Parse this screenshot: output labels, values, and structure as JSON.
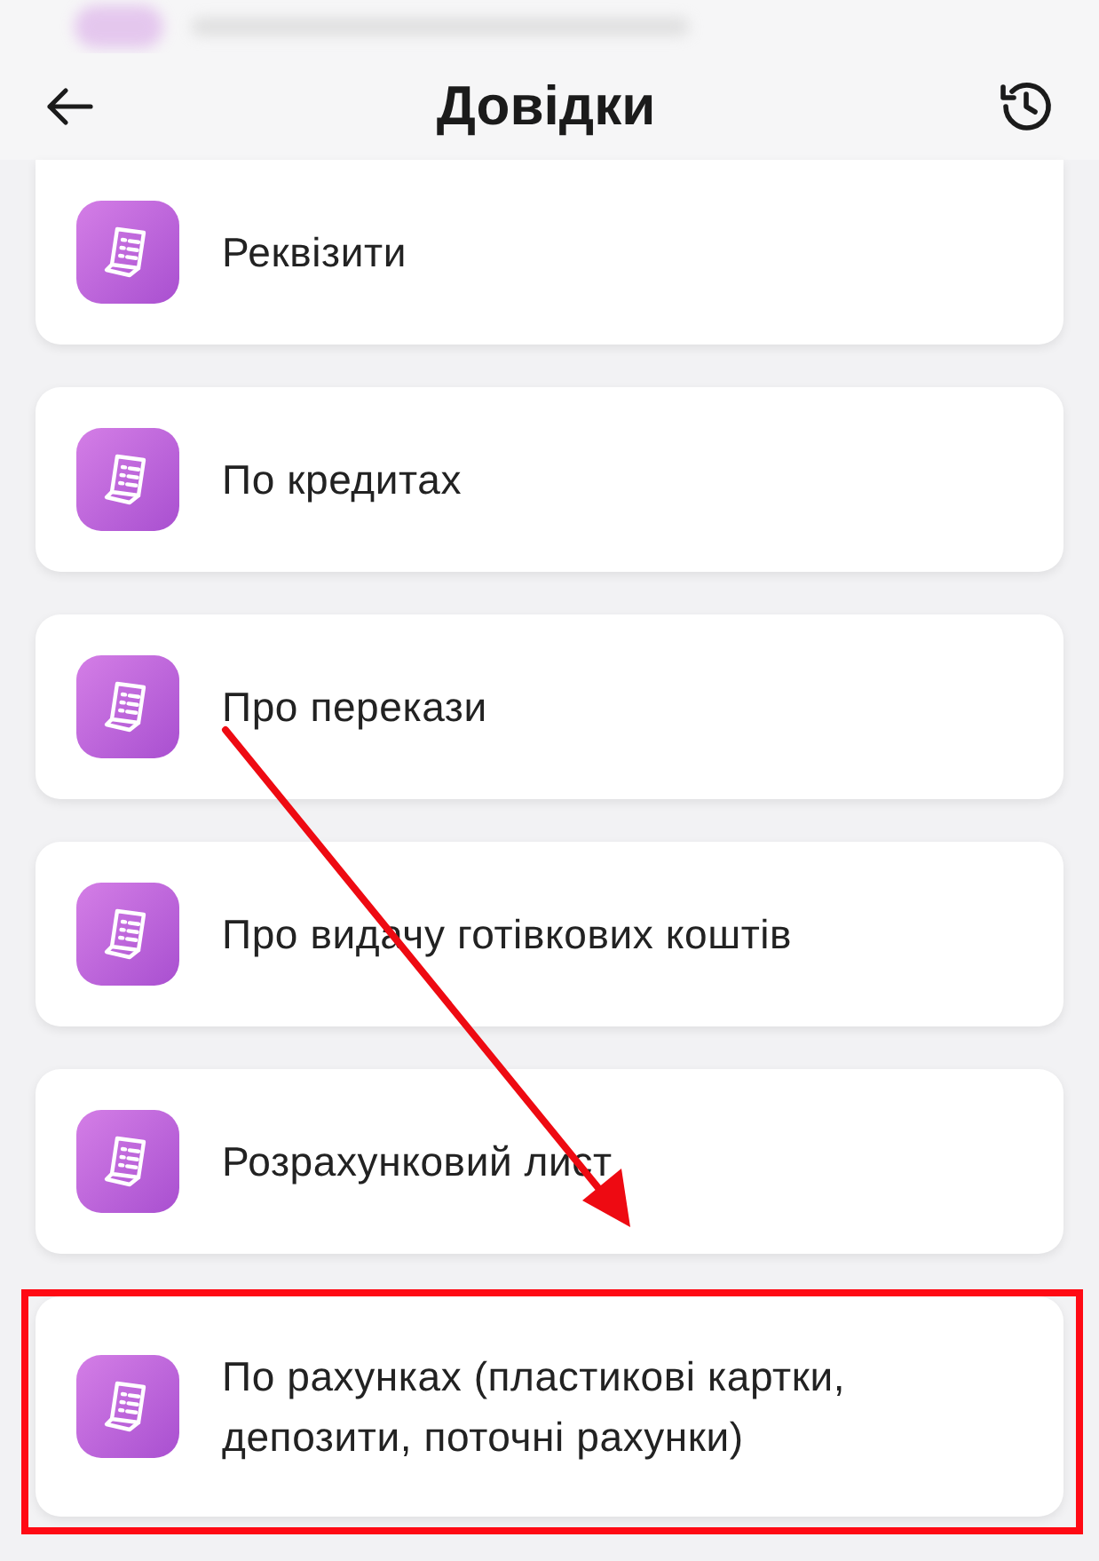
{
  "header": {
    "title": "Довідки"
  },
  "items": [
    {
      "label": "Реквізити",
      "highlighted": false
    },
    {
      "label": "По кредитах",
      "highlighted": false
    },
    {
      "label": "Про перекази",
      "highlighted": false
    },
    {
      "label": "Про видачу готівкових коштів",
      "highlighted": false
    },
    {
      "label": "Розрахунковий лист",
      "highlighted": false
    },
    {
      "label": "По рахунках (пластикові картки, депозити, поточні рахунки)",
      "highlighted": true
    }
  ]
}
